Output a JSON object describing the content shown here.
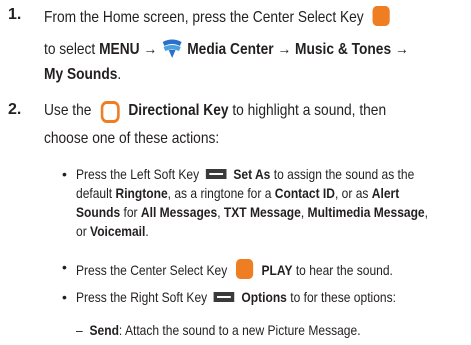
{
  "step1": {
    "number": "1.",
    "line1": "From the Home screen, press the Center Select Key",
    "line2_pre": "to select",
    "menu": "MENU",
    "arrow1": "→",
    "media_center": "Media Center",
    "arrow2": "→",
    "music_tones": "Music & Tones",
    "arrow3": "→",
    "my_sounds": "My Sounds",
    "period": "."
  },
  "step2": {
    "number": "2.",
    "use_the": "Use the",
    "directional_key": "Directional Key",
    "line1_post": "to highlight a sound, then",
    "line2": "choose one of these actions:"
  },
  "bullets": {
    "b1": {
      "pre": "Press the Left Soft Key",
      "set_as": "Set As",
      "post": "to assign the sound as the",
      "l2_pre": "default",
      "ringtone": "Ringtone",
      "l2_mid": ", as a ringtone for a",
      "contact_id": "Contact ID",
      "l2_post": ", or as",
      "alert": "Alert",
      "sounds": "Sounds",
      "for": "for",
      "all_messages": "All Messages",
      "comma1": ",",
      "txt_message": "TXT Message",
      "comma2": ",",
      "multimedia_message": "Multimedia Message",
      "comma3": ",",
      "or": "or",
      "voicemail": "Voicemail",
      "period": "."
    },
    "b2": {
      "pre": "Press the Center Select Key",
      "play": "PLAY",
      "post": "to hear the sound."
    },
    "b3": {
      "pre": "Press the Right Soft Key",
      "options": "Options",
      "post": "to for these options:"
    },
    "sub1": {
      "dash": "–",
      "send": "Send",
      "post": ": Attach the sound to a new Picture Message."
    }
  }
}
